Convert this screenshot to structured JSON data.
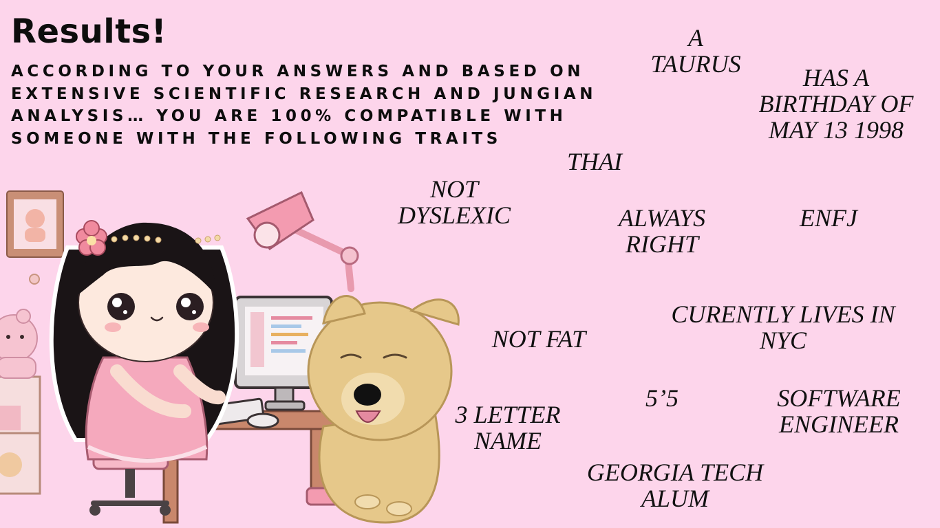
{
  "title": "Results!",
  "subtitle": "According to your answers and based on extensive scientific research and jungian analysis… you are 100% compatible with someone with the following traits",
  "traits": {
    "a_taurus_line1": "A",
    "a_taurus_line2": "TAURUS",
    "birthday_line1": "HAS A",
    "birthday_line2": "BIRTHDAY OF",
    "birthday_line3": "MAY 13 1998",
    "thai": "THAI",
    "not_dyslexic_line1": "NOT",
    "not_dyslexic_line2": "DYSLEXIC",
    "always_right_line1": "ALWAYS",
    "always_right_line2": "RIGHT",
    "enfj": "ENFJ",
    "lives_line1": "CURENTLY LIVES IN",
    "lives_line2": "NYC",
    "not_fat": "NOT FAT",
    "height": "5’5",
    "name_line1": "3 LETTER",
    "name_line2": "NAME",
    "job_line1": "SOFTWARE",
    "job_line2": "ENGINEER",
    "school_line1": "GEORGIA TECH",
    "school_line2": "ALUM"
  },
  "colors": {
    "background": "#fdd5eb",
    "text": "#111111",
    "accent_pink": "#f4a6c3",
    "dog": "#e6c88a",
    "hair": "#1a1416"
  }
}
